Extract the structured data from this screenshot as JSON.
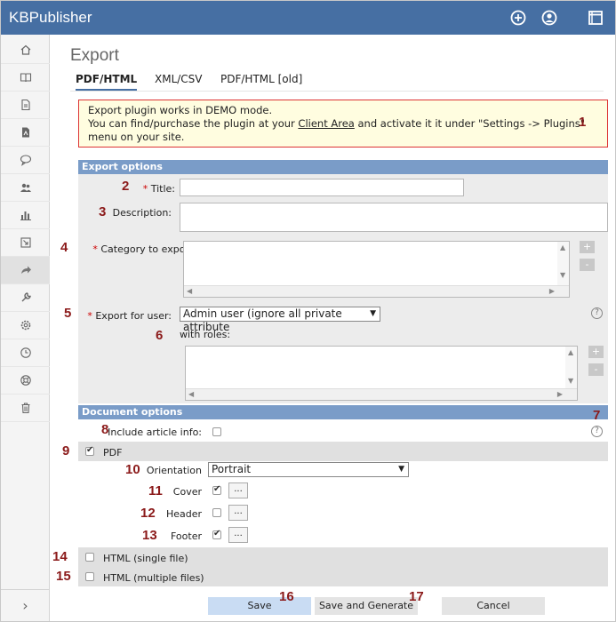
{
  "app": {
    "name": "KBPublisher"
  },
  "topbar_icons": [
    "plus-circle-icon",
    "user-icon",
    "window-icon"
  ],
  "sidebar": {
    "items": [
      {
        "icon": "home-icon"
      },
      {
        "icon": "book-icon"
      },
      {
        "icon": "file-icon"
      },
      {
        "icon": "file-pdf-icon"
      },
      {
        "icon": "chat-icon"
      },
      {
        "icon": "users-icon"
      },
      {
        "icon": "bar-chart-icon"
      },
      {
        "icon": "import-icon"
      },
      {
        "icon": "export-arrow-icon"
      },
      {
        "icon": "wrench-icon"
      },
      {
        "icon": "gear-icon"
      },
      {
        "icon": "clock-icon"
      },
      {
        "icon": "lifebuoy-icon"
      },
      {
        "icon": "trash-icon"
      }
    ],
    "expand_glyph": "›"
  },
  "page": {
    "title": "Export"
  },
  "tabs": [
    {
      "label": "PDF/HTML",
      "active": true
    },
    {
      "label": "XML/CSV",
      "active": false
    },
    {
      "label": "PDF/HTML [old]",
      "active": false
    }
  ],
  "notice": {
    "line1": "Export plugin works in DEMO mode.",
    "line2_pre": "You can find/purchase the plugin at your ",
    "line2_link": "Client Area",
    "line2_post": " and activate it it under \"Settings -> Plugins\"",
    "line3": "menu on your site."
  },
  "export_options": {
    "header": "Export options",
    "title_label": "Title:",
    "title_value": "",
    "description_label": "Description:",
    "description_value": "",
    "category_label": "Category to export:",
    "export_for_user_label": "Export for user:",
    "export_for_user_value": "Admin user (ignore all private attribute",
    "with_roles_label": "with roles:",
    "required_mark": "*",
    "plus": "+",
    "minus": "-",
    "help": "?"
  },
  "document_options": {
    "header": "Document options",
    "include_article_info_label": "Include article info:",
    "include_article_info_checked": false,
    "pdf_label": "PDF",
    "pdf_checked": true,
    "orientation_label": "Orientation",
    "orientation_value": "Portrait",
    "cover_label": "Cover",
    "cover_checked": true,
    "header_label": "Header",
    "header_checked": false,
    "footer_label": "Footer",
    "footer_checked": true,
    "dots": "...",
    "html_single_label": "HTML (single file)",
    "html_single_checked": false,
    "html_multiple_label": "HTML (multiple files)",
    "html_multiple_checked": false
  },
  "buttons": {
    "save": "Save",
    "save_and_generate": "Save and Generate",
    "cancel": "Cancel"
  },
  "annotations": [
    "1",
    "2",
    "3",
    "4",
    "5",
    "6",
    "7",
    "8",
    "9",
    "10",
    "11",
    "12",
    "13",
    "14",
    "15",
    "16",
    "17"
  ],
  "colors": {
    "topbar": "#466fa3",
    "section_header": "#7a9cc8",
    "notice_bg": "#fffde0",
    "notice_border": "#dd3333",
    "annotation": "#8b1a1a",
    "save_button": "#c9dcf3"
  }
}
